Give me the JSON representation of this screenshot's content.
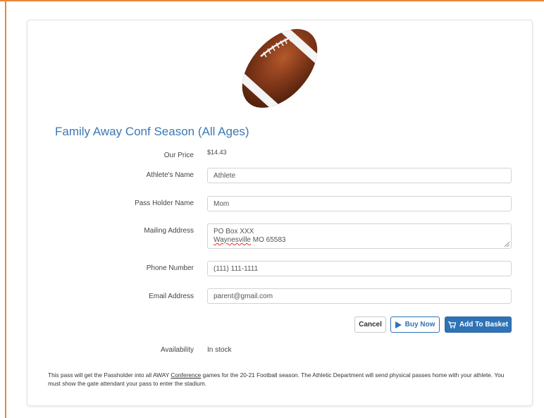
{
  "product": {
    "title": "Family Away Conf Season (All Ages)",
    "image_icon": "football-icon"
  },
  "price": {
    "label": "Our Price",
    "value": "$14.43"
  },
  "form": {
    "athlete_name": {
      "label": "Athlete's Name",
      "value": "Athlete"
    },
    "pass_holder_name": {
      "label": "Pass Holder Name",
      "value": "Mom"
    },
    "mailing_address": {
      "label": "Mailing Address",
      "line1": "PO Box XXX",
      "line2_city": "Waynesville",
      "line2_rest": " MO 65583"
    },
    "phone_number": {
      "label": "Phone Number",
      "value": "(111) 111-1111"
    },
    "email_address": {
      "label": "Email Address",
      "value": "parent@gmail.com"
    }
  },
  "buttons": {
    "cancel": "Cancel",
    "buy_now": "Buy Now",
    "buy_now_icon": "play-icon",
    "add_to_basket": "Add To Basket",
    "add_to_basket_icon": "cart-icon"
  },
  "availability": {
    "label": "Availability",
    "value": "In stock"
  },
  "description": {
    "part1": "This pass will get the Passholder into all AWAY ",
    "link": "Conference",
    "part2": " games for the 20-21 Football season. The Athletic Department will send physical passes home with your athlete. You must show the gate attendant your pass to enter the stadium."
  },
  "colors": {
    "accent": "#2f73b6",
    "title": "#3c79b4",
    "frame": "#e8853a",
    "football": "#7a3417"
  }
}
